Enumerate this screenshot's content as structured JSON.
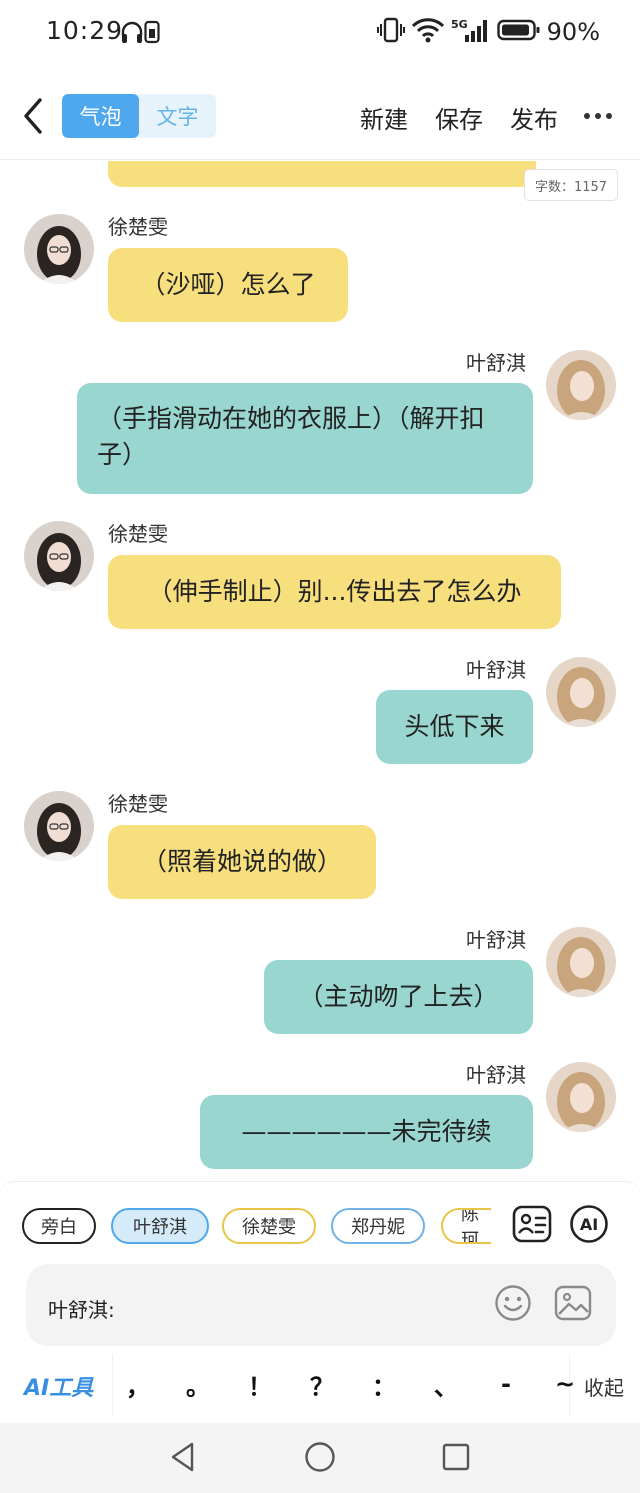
{
  "status_bar": {
    "time": "10:29",
    "battery": "90%",
    "network": "5G"
  },
  "header": {
    "tabs": [
      {
        "label": "气泡",
        "active": true
      },
      {
        "label": "文字",
        "active": false
      }
    ],
    "actions": {
      "new": "新建",
      "save": "保存",
      "publish": "发布"
    },
    "icons": {
      "back": "chevron-left-icon",
      "more": "more-horizontal-icon"
    }
  },
  "chat": {
    "word_count": "字数：1157",
    "colors": {
      "left_bubble": "#f8df7d",
      "right_bubble": "#99d6cf"
    },
    "messages": [
      {
        "speaker": "徐楚雯",
        "side": "left",
        "text": "（沙哑）怎么了"
      },
      {
        "speaker": "叶舒淇",
        "side": "right",
        "text": "（手指滑动在她的衣服上）（解开扣子）"
      },
      {
        "speaker": "徐楚雯",
        "side": "left",
        "text": "（伸手制止）别...传出去了怎么办"
      },
      {
        "speaker": "叶舒淇",
        "side": "right",
        "text": "头低下来"
      },
      {
        "speaker": "徐楚雯",
        "side": "left",
        "text": "（照着她说的做）"
      },
      {
        "speaker": "叶舒淇",
        "side": "right",
        "text": "（主动吻了上去）"
      },
      {
        "speaker": "叶舒淇",
        "side": "right",
        "text": "——————未完待续"
      }
    ]
  },
  "composer": {
    "roles": [
      {
        "label": "旁白",
        "selected": false
      },
      {
        "label": "叶舒淇",
        "selected": true
      },
      {
        "label": "徐楚雯",
        "selected": false
      },
      {
        "label": "郑丹妮",
        "selected": false
      },
      {
        "label": "陈珂",
        "selected": false
      }
    ],
    "input_prefix": "叶舒淇:",
    "ai_tools_label": "AI工具",
    "punctuation": [
      "，",
      "。",
      "！",
      "？",
      "：",
      "、",
      "-",
      "~"
    ],
    "collapse_label": "收起",
    "icons": {
      "role_card": "id-card-icon",
      "ai": "ai-circle-icon",
      "emoji": "emoji-icon",
      "image": "image-icon"
    }
  },
  "nav_bar": {
    "icons": [
      "back-triangle-icon",
      "home-circle-icon",
      "recents-square-icon"
    ]
  }
}
